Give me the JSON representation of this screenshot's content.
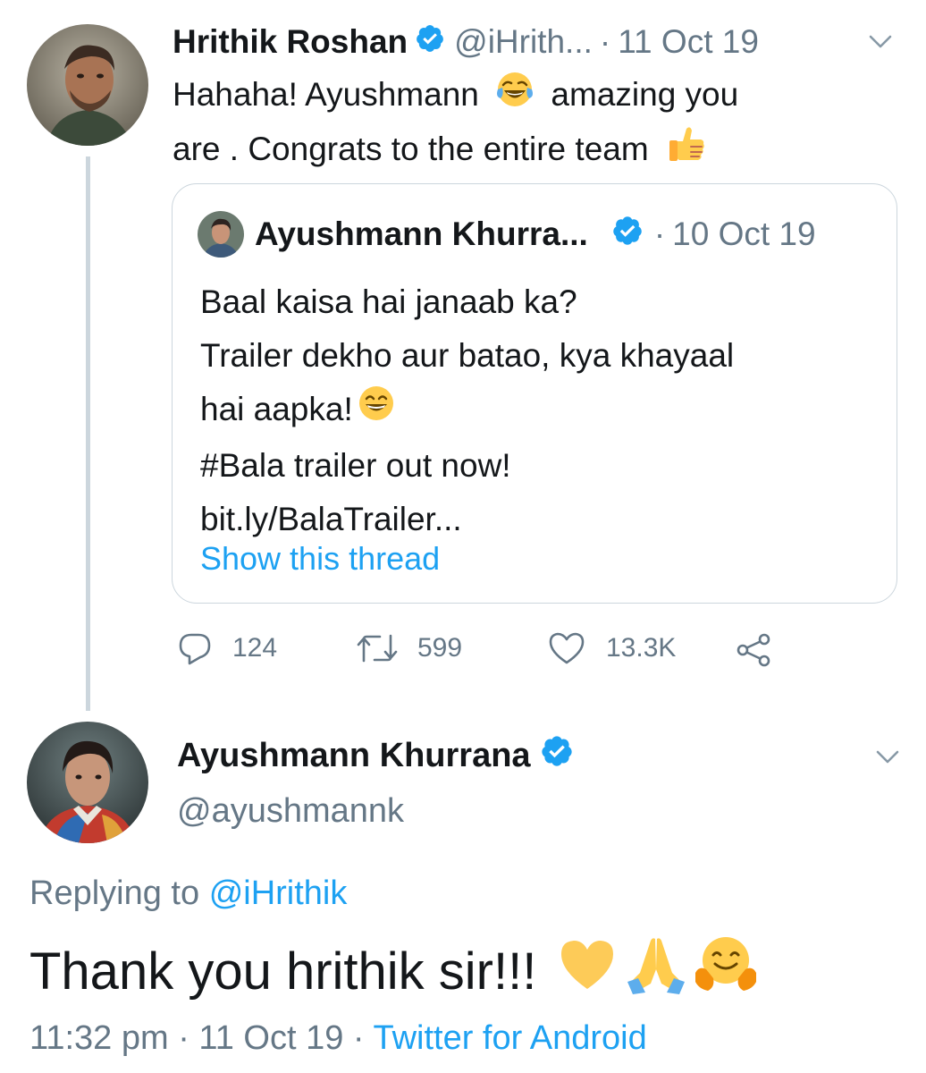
{
  "tweet": {
    "author_name": "Hrithik Roshan",
    "author_handle": "@iHrith...",
    "separator": "·",
    "date": "11 Oct 19",
    "text_line1_a": "Hahaha! Ayushmann",
    "text_line1_b": "amazing you",
    "text_line2": "are . Congrats to the entire team"
  },
  "quoted": {
    "author_name": "Ayushmann Khurra...",
    "separator": "·",
    "date": "10 Oct 19",
    "line1": "Baal kaisa hai janaab ka?",
    "line2": "Trailer dekho aur batao, kya khayaal",
    "line3": "hai aapka!",
    "line4": "#Bala trailer out now!",
    "line5": "bit.ly/BalaTrailer...",
    "show_thread": "Show this thread"
  },
  "actions": {
    "replies": "124",
    "retweets": "599",
    "likes": "13.3K"
  },
  "reply": {
    "author_name": "Ayushmann Khurrana",
    "author_handle": "@ayushmannk",
    "replying_prefix": "Replying to",
    "replying_handle": "@iHrithik",
    "text": "Thank you hrithik sir!!!",
    "time": "11:32 pm",
    "separator1": "·",
    "date": "11 Oct 19",
    "separator2": "·",
    "source": "Twitter for Android"
  },
  "colors": {
    "accent": "#1da1f2",
    "muted": "#657786",
    "border": "#ccd6dd",
    "text": "#14171a"
  },
  "icons": [
    "verified-badge-icon",
    "chevron-down-icon",
    "reply-icon",
    "retweet-icon",
    "like-icon",
    "share-icon",
    "tears-of-joy-emoji",
    "thumbs-up-emoji",
    "grinning-emoji",
    "yellow-heart-emoji",
    "folded-hands-emoji",
    "hugging-face-emoji"
  ]
}
